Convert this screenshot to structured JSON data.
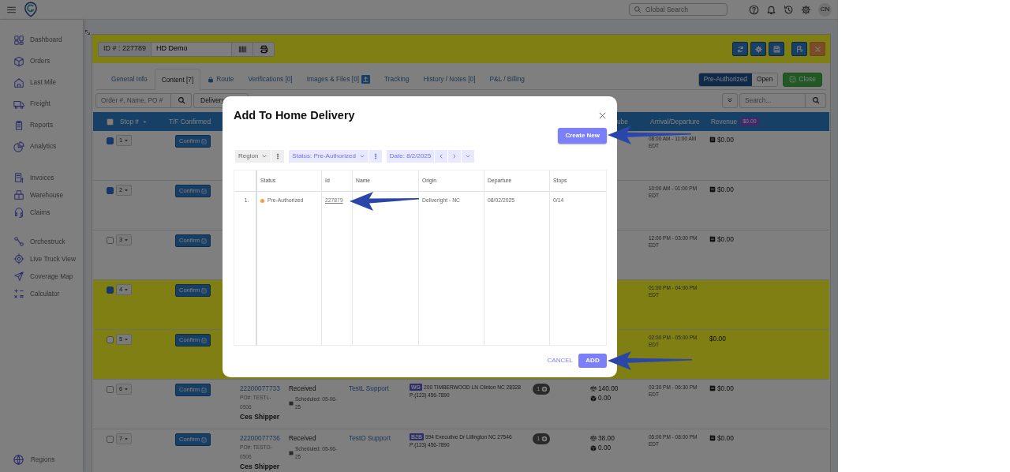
{
  "topbar": {
    "search_placeholder": "Global Search",
    "avatar": "CN"
  },
  "sidebar": {
    "groups": [
      {
        "items": [
          {
            "label": "Dashboard"
          },
          {
            "label": "Orders"
          },
          {
            "label": "Last Mile"
          },
          {
            "label": "Freight"
          },
          {
            "label": "Reports"
          },
          {
            "label": "Analytics"
          }
        ]
      },
      {
        "items": [
          {
            "label": "Invoices"
          },
          {
            "label": "Warehouse"
          },
          {
            "label": "Claims"
          }
        ]
      },
      {
        "items": [
          {
            "label": "Orchestruck"
          },
          {
            "label": "Live Truck View"
          },
          {
            "label": "Coverage Map"
          },
          {
            "label": "Calculator"
          }
        ]
      }
    ],
    "footer": {
      "label": "Regions"
    }
  },
  "order": {
    "id_label": "ID # : 227789",
    "name": "HD Demo"
  },
  "tabs": [
    {
      "label": "General Info",
      "kind": "plain",
      "selected": false
    },
    {
      "label": "Content [7]",
      "kind": "plain",
      "selected": true
    },
    {
      "label": "Route",
      "kind": "locked",
      "selected": false
    },
    {
      "label": "Verifications [0]",
      "kind": "plain",
      "selected": false
    },
    {
      "label": "Images & Files [0]",
      "kind": "upload",
      "selected": false
    },
    {
      "label": "Tracking",
      "kind": "plain",
      "selected": false
    },
    {
      "label": "History / Notes [0]",
      "kind": "plain",
      "selected": false
    },
    {
      "label": "P&L / Billing",
      "kind": "plain",
      "selected": false
    }
  ],
  "status_toggle": [
    {
      "label": "Pre-Authorized",
      "selected": true
    },
    {
      "label": "Open",
      "selected": false
    }
  ],
  "close_button": {
    "label": "Close"
  },
  "filters": {
    "search_placeholder": "Order #, Name, PO #",
    "type": "Delivery",
    "table_search_placeholder": "Search..."
  },
  "table": {
    "select_all_checked": false,
    "columns": {
      "stop": "Stop #",
      "confirmed": "T/F Confirmed",
      "cube": "ube",
      "arrival": "Arrival/Departure",
      "revenue": "Revenue"
    },
    "revenue_total": "$0.00",
    "rows": [
      {
        "stop": "1",
        "checked": true,
        "highlighted": false,
        "confirm": "Confirm",
        "arrival": "08:00 AM - 11:00 AM",
        "zone": "EDT",
        "revenue": "$0.00",
        "invoiced": true
      },
      {
        "stop": "2",
        "checked": true,
        "highlighted": false,
        "confirm": "Confirm",
        "arrival": "10:00 AM - 01:00 PM",
        "zone": "EDT",
        "revenue": "$0.00",
        "invoiced": true
      },
      {
        "stop": "3",
        "checked": false,
        "highlighted": false,
        "confirm": "Confirm",
        "arrival": "12:00 PM - 03:00 PM",
        "zone": "EDT",
        "revenue": "$0.00",
        "invoiced": true
      },
      {
        "stop": "4",
        "checked": true,
        "highlighted": true,
        "confirm": "Confirm",
        "arrival": "01:00 PM - 04:00 PM",
        "zone": "EDT"
      },
      {
        "stop": "5",
        "checked": false,
        "highlighted": true,
        "confirm": "Confirm",
        "arrival": "02:00 PM - 05:00 PM",
        "zone": "EDT",
        "revenue": "$0.00",
        "invoiced": false
      },
      {
        "stop": "6",
        "checked": false,
        "highlighted": false,
        "confirm": "Confirm",
        "order_no": "22200077733",
        "po": "PO#: TESTL-0506",
        "shipper": "Ces Shipper",
        "status": "Received",
        "scheduled": "Scheduled: 05-06-25",
        "customer": "TestL Support",
        "address_tag": "WG",
        "address": "200 TIMBERWOOD LN Clinton NC 28328",
        "phone": "P:(123) 456-7890",
        "count": "1",
        "weight": "140.00",
        "cube": "0.00",
        "arrival": "03:30 PM - 06:30 PM",
        "zone": "EDT",
        "revenue": "$0.00",
        "invoiced": true
      },
      {
        "stop": "7",
        "checked": false,
        "highlighted": false,
        "confirm": "Confirm",
        "order_no": "22200077736",
        "po": "PO#: TESTO-0506",
        "shipper": "Ces Shipper",
        "status": "Received",
        "scheduled": "Scheduled: 05-06-25",
        "customer": "TestO Support",
        "address_tag": "B2B",
        "address": "594 Executive Dr Lillington NC 27546",
        "phone": "P:(123) 456-7890",
        "count": "1",
        "weight": "38.00",
        "cube": "0.00",
        "arrival": "05:00 PM - 08:00 PM",
        "zone": "EDT",
        "revenue": "$0.00",
        "invoiced": true
      }
    ]
  },
  "modal": {
    "title": "Add To Home Delivery",
    "create_button": "Create New",
    "filters": [
      {
        "kind": "select",
        "label": "Region"
      },
      {
        "kind": "select_active",
        "label": "Status: Pre-Authorized"
      },
      {
        "kind": "date",
        "label": "Date: 8/2/2025"
      }
    ],
    "columns": [
      "Status",
      "Id",
      "Name",
      "Origin",
      "Departure",
      "Stops"
    ],
    "rows": [
      {
        "index": "1.",
        "status": "Pre-Authorized",
        "color": "#f5a040",
        "id": "227879",
        "origin": "Deliveright - NC",
        "departure": "08/02/2025",
        "stops": "0/14"
      }
    ],
    "cancel_button": "CANCEL",
    "add_button": "ADD"
  }
}
